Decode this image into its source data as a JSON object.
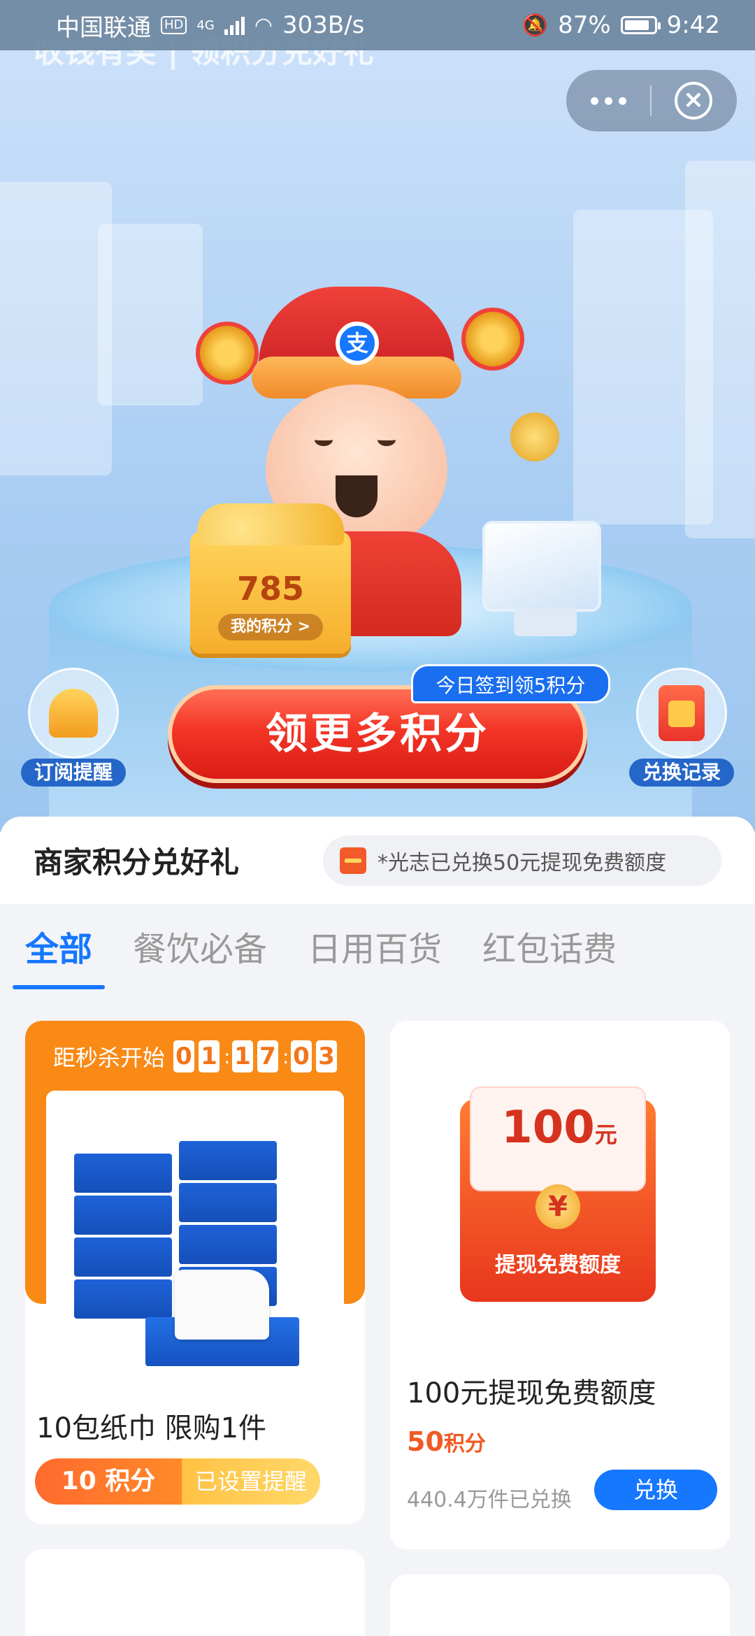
{
  "status_bar": {
    "carrier": "中国联通",
    "hd": "HD",
    "network": "4G",
    "speed": "303B/s",
    "battery": "87%",
    "time": "9:42"
  },
  "hero": {
    "title": "收钱有奖 | 领积分兑好礼",
    "points_value": "785",
    "points_label": "我的积分 >",
    "checkin_tag": "今日签到领5积分",
    "main_button": "领更多积分",
    "subscribe_label": "订阅提醒",
    "records_label": "兑换记录"
  },
  "section": {
    "title": "商家积分兑好礼",
    "ticker": "*光志已兑换50元提现免费额度"
  },
  "tabs": [
    "全部",
    "餐饮必备",
    "日用百货",
    "红包话费"
  ],
  "card_flash": {
    "countdown_label": "距秒杀开始",
    "countdown_digits": [
      "0",
      "1",
      "1",
      "7",
      "0",
      "3"
    ],
    "name": "10包纸巾 限购1件",
    "points": "10 积分",
    "remind_status": "已设置提醒"
  },
  "card_cash": {
    "amount": "100",
    "unit": "元",
    "coin_symbol": "¥",
    "packet_label": "提现免费额度",
    "name": "100元提现免费额度",
    "price_value": "50",
    "price_unit": "积分",
    "sold": "440.4万件已兑换",
    "button": "兑换"
  },
  "colors": {
    "accent_blue": "#1677ff",
    "orange": "#f98a16",
    "red": "#f33526"
  }
}
